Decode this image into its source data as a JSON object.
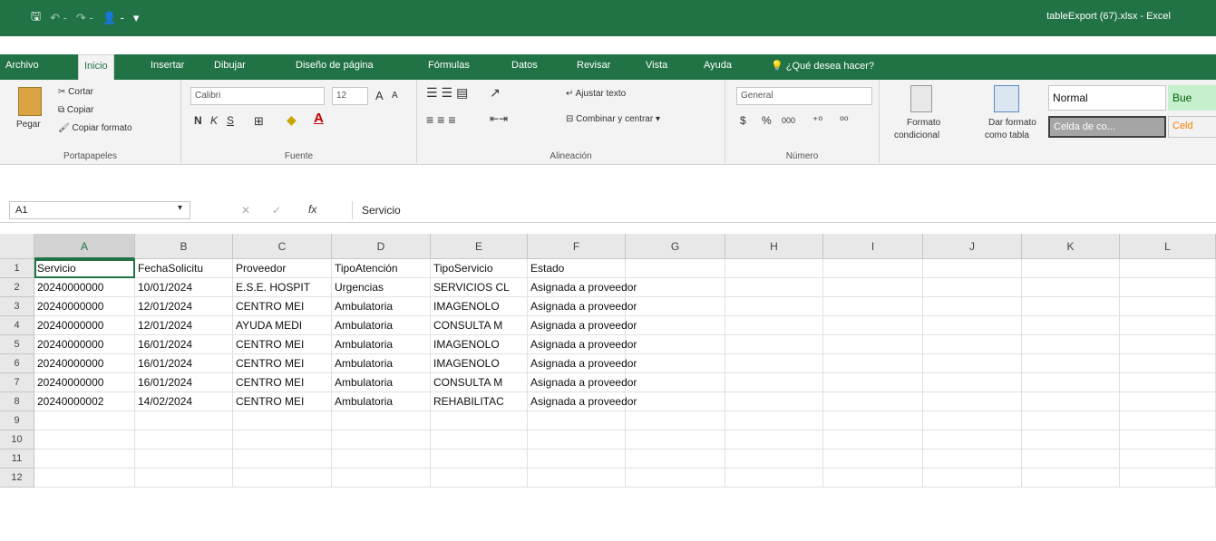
{
  "window": {
    "title": "tableExport (67).xlsx  -  Excel"
  },
  "qat": {
    "save": "🖫",
    "undo": "↶ -",
    "redo": "↷ -",
    "touch": "👤 -",
    "more": "▾"
  },
  "tabs": [
    "Archivo",
    "Inicio",
    "Insertar",
    "Dibujar",
    "Diseño de página",
    "Fórmulas",
    "Datos",
    "Revisar",
    "Vista",
    "Ayuda",
    "¿Qué desea hacer?"
  ],
  "ribbon": {
    "clipboard": {
      "paste": "Pegar",
      "cut": "Cortar",
      "copy": "Copiar",
      "format_painter": "Copiar formato",
      "label": "Portapapeles"
    },
    "font": {
      "name": "Calibri",
      "size": "12",
      "bold": "N",
      "italic": "K",
      "underline": "S",
      "label": "Fuente"
    },
    "alignment": {
      "wrap": "Ajustar texto",
      "merge": "Combinar y centrar",
      "label": "Alineación"
    },
    "number": {
      "format": "General",
      "currency": "$",
      "percent": "%",
      "thousands": "000",
      "inc_decimals": "⁺⁰",
      "dec_decimals": "⁰⁰",
      "label": "Número"
    },
    "styles": {
      "cond_format_1": "Formato",
      "cond_format_2": "condicional",
      "table_format_1": "Dar formato",
      "table_format_2": "como tabla",
      "normal": "Normal",
      "good": "Bue",
      "check": "Celda de co...",
      "calc": "Celd"
    }
  },
  "formula_bar": {
    "cell": "A1",
    "fx": "fx",
    "value": "Servicio"
  },
  "grid": {
    "columns": [
      "A",
      "B",
      "C",
      "D",
      "E",
      "F",
      "G",
      "H",
      "I",
      "J",
      "K",
      "L"
    ],
    "rows": [
      "1",
      "2",
      "3",
      "4",
      "5",
      "6",
      "7",
      "8",
      "9",
      "10",
      "11",
      "12"
    ],
    "data": [
      [
        "Servicio",
        "FechaSolicitu",
        "Proveedor",
        "TipoAtención",
        "TipoServicio",
        "Estado"
      ],
      [
        "20240000000",
        "10/01/2024",
        "E.S.E. HOSPIT",
        "Urgencias",
        "SERVICIOS CL",
        "Asignada a proveedor"
      ],
      [
        "20240000000",
        "12/01/2024",
        "CENTRO MEI",
        "Ambulatoria",
        "IMAGENOLO",
        "Asignada a proveedor"
      ],
      [
        "20240000000",
        "12/01/2024",
        "AYUDA MEDI",
        "Ambulatoria",
        "CONSULTA M",
        "Asignada a proveedor"
      ],
      [
        "20240000000",
        "16/01/2024",
        "CENTRO MEI",
        "Ambulatoria",
        "IMAGENOLO",
        "Asignada a proveedor"
      ],
      [
        "20240000000",
        "16/01/2024",
        "CENTRO MEI",
        "Ambulatoria",
        "IMAGENOLO",
        "Asignada a proveedor"
      ],
      [
        "20240000000",
        "16/01/2024",
        "CENTRO MEI",
        "Ambulatoria",
        "CONSULTA M",
        "Asignada a proveedor"
      ],
      [
        "20240000002",
        "14/02/2024",
        "CENTRO MEI",
        "Ambulatoria",
        "REHABILITAC",
        "Asignada a proveedor"
      ]
    ]
  }
}
